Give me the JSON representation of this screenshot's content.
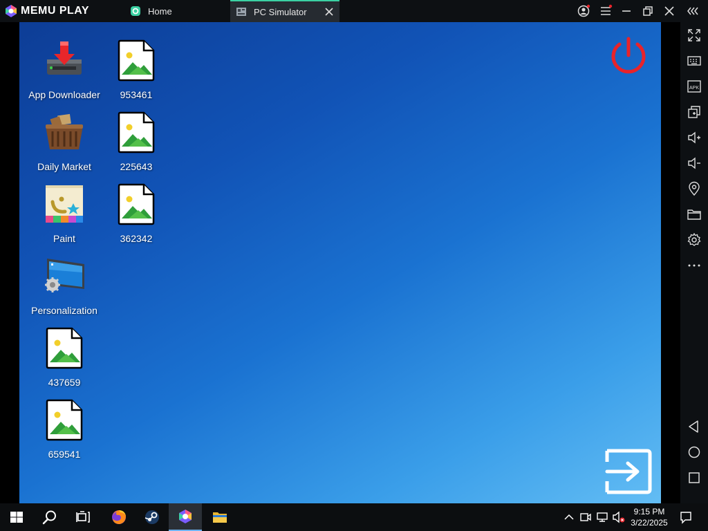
{
  "titlebar": {
    "app_name": "MEMU PLAY",
    "tabs": [
      {
        "label": "Home",
        "icon": "home-app-icon",
        "active": false
      },
      {
        "label": "PC Simulator",
        "icon": "pc-simulator-app-icon",
        "active": true
      }
    ]
  },
  "desktop": {
    "icons": [
      {
        "label": "App Downloader",
        "icon": "app-downloader-icon"
      },
      {
        "label": "953461",
        "icon": "image-file-icon"
      },
      {
        "label": "Daily Market",
        "icon": "daily-market-basket-icon"
      },
      {
        "label": "225643",
        "icon": "image-file-icon"
      },
      {
        "label": "Paint",
        "icon": "paint-icon"
      },
      {
        "label": "362342",
        "icon": "image-file-icon"
      },
      {
        "label": "Personalization",
        "icon": "personalization-monitor-icon"
      },
      {
        "label": "437659",
        "icon": "image-file-icon"
      },
      {
        "label": "659541",
        "icon": "image-file-icon"
      }
    ]
  },
  "colors": {
    "power": "#e8232a",
    "tab_accent": "#3bd1a3",
    "desktop_top": "#0d3d96",
    "desktop_bottom": "#63bdf4"
  },
  "taskbar": {
    "time": "9:15 PM",
    "date": "3/22/2025"
  }
}
